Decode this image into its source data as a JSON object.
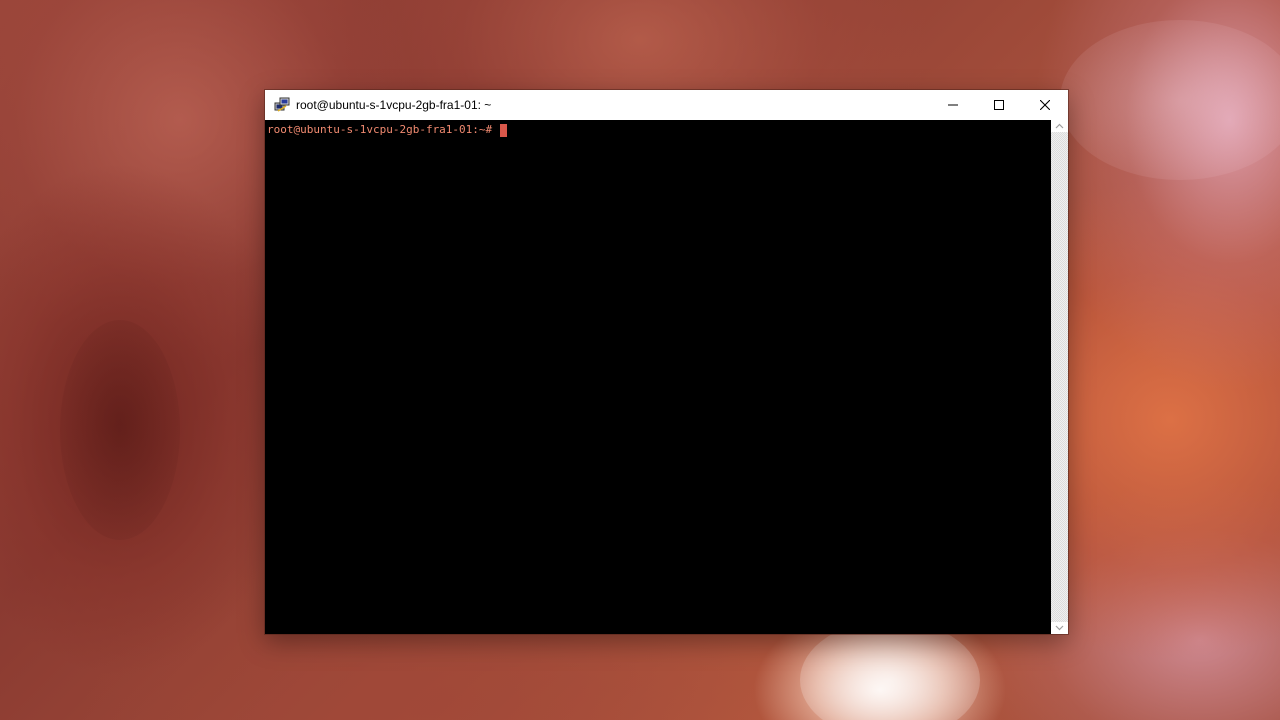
{
  "window": {
    "title": "root@ubuntu-s-1vcpu-2gb-fra1-01: ~",
    "app_icon": "putty-icon"
  },
  "controls": {
    "minimize_icon": "minimize-icon",
    "maximize_icon": "maximize-icon",
    "close_icon": "close-icon"
  },
  "terminal": {
    "prompt": "root@ubuntu-s-1vcpu-2gb-fra1-01:~# ",
    "text_color": "#f08a70",
    "cursor_color": "#d9574a",
    "background": "#000000"
  },
  "scrollbar": {
    "up_icon": "chevron-up-icon",
    "down_icon": "chevron-down-icon"
  }
}
